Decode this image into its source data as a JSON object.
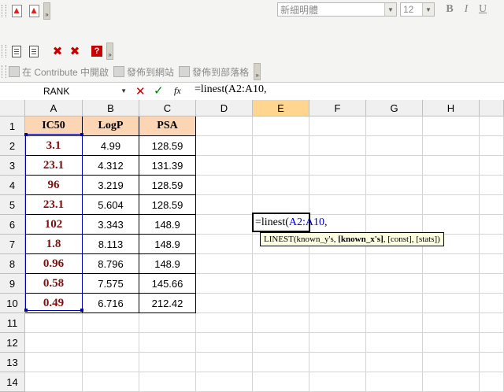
{
  "toolbar": {
    "font_name": "新細明體",
    "font_size": "12",
    "bold_label": "B",
    "italic_label": "I",
    "underline_label": "U",
    "contribute_items": [
      "在 Contribute 中開啟",
      "發佈到網站",
      "發佈到部落格"
    ],
    "more_label": "»"
  },
  "formula_bar": {
    "name_box": "RANK",
    "cancel_label": "✕",
    "enter_label": "✓",
    "fx_label": "fx",
    "formula": "=linest(A2:A10,"
  },
  "columns": [
    "A",
    "B",
    "C",
    "D",
    "E",
    "F",
    "G",
    "H"
  ],
  "rows": [
    "1",
    "2",
    "3",
    "4",
    "5",
    "6",
    "7",
    "8",
    "9",
    "10",
    "11",
    "12",
    "13",
    "14"
  ],
  "table": {
    "headers": [
      "IC50",
      "LogP",
      "PSA"
    ],
    "rows": [
      [
        "3.1",
        "4.99",
        "128.59"
      ],
      [
        "23.1",
        "4.312",
        "131.39"
      ],
      [
        "96",
        "3.219",
        "128.59"
      ],
      [
        "23.1",
        "5.604",
        "128.59"
      ],
      [
        "102",
        "3.343",
        "148.9"
      ],
      [
        "1.8",
        "8.113",
        "148.9"
      ],
      [
        "0.96",
        "8.796",
        "148.9"
      ],
      [
        "0.58",
        "7.575",
        "145.66"
      ],
      [
        "0.49",
        "6.716",
        "212.42"
      ]
    ]
  },
  "edit_cell": {
    "prefix": "=linest(",
    "ref": "A2:A10",
    "suffix": ","
  },
  "tooltip": {
    "fn": "LINEST(known_y's, ",
    "bold": "[known_x's]",
    "rest": ", [const], [stats])"
  },
  "colors": {
    "header_fill": "#fcd5b4",
    "ic50_text": "#7b1010",
    "ref_blue": "#0000cc"
  }
}
